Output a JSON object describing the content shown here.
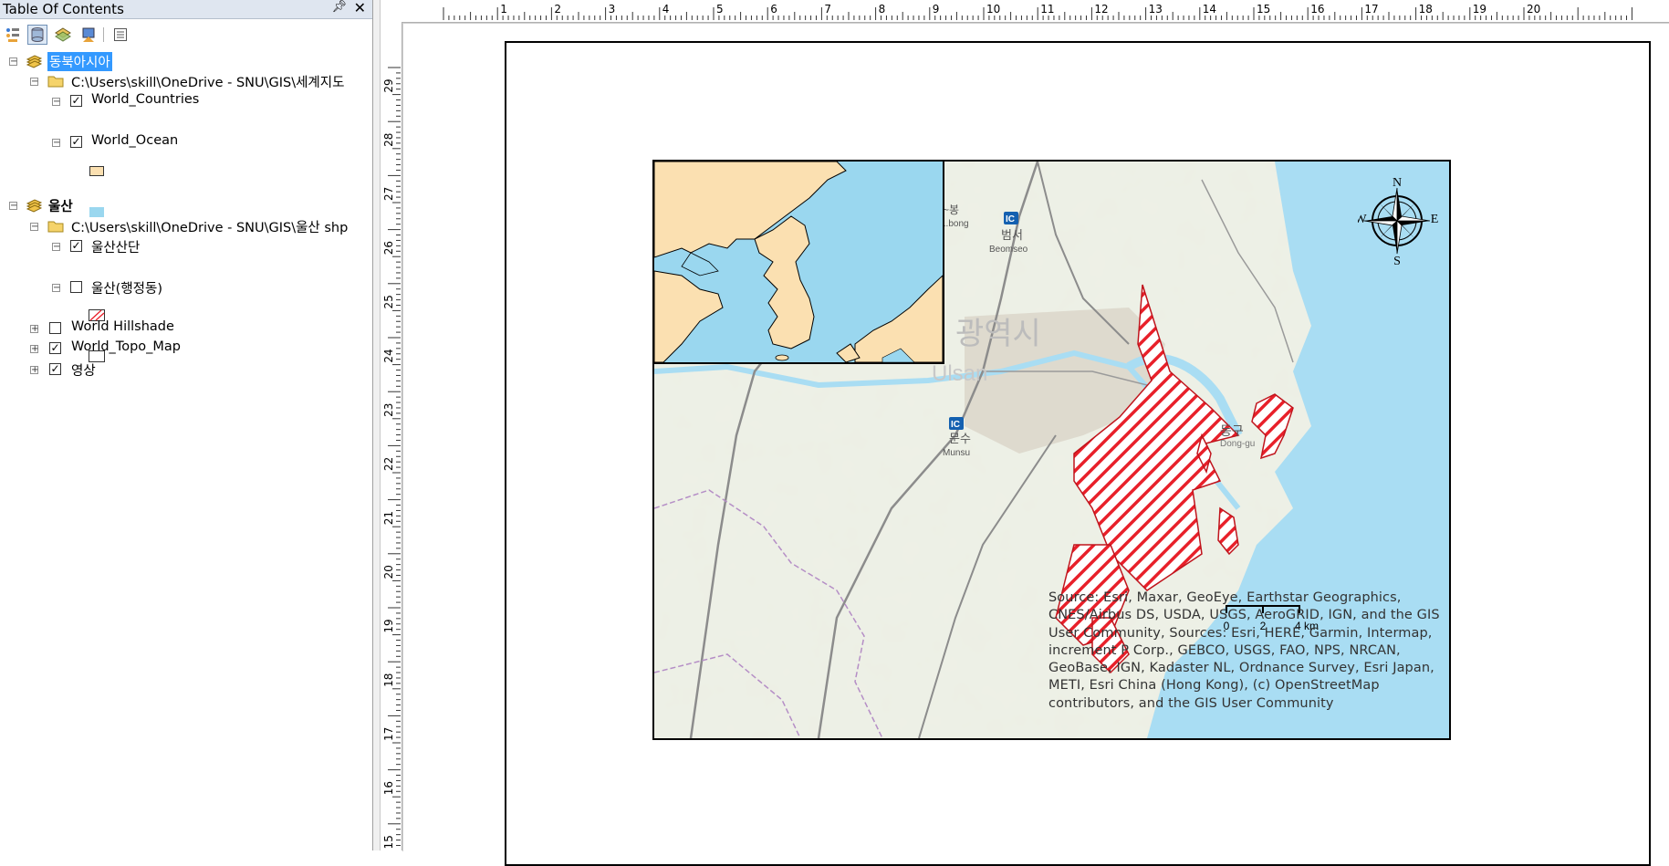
{
  "toc": {
    "title": "Table Of Contents",
    "groups": [
      {
        "name": "동북아시아",
        "selected": true,
        "source_path": "C:\\Users\\skill\\OneDrive - SNU\\GIS\\세계지도",
        "layers": [
          {
            "name": "World_Countries",
            "checked": true,
            "swatch_color": "#fbe0b1"
          },
          {
            "name": "World_Ocean",
            "checked": true,
            "swatch_color": "#9ad7ef"
          }
        ]
      },
      {
        "name": "울산",
        "selected": false,
        "source_path": "C:\\Users\\skill\\OneDrive - SNU\\GIS\\울산 shp",
        "layers": [
          {
            "name": "울산산단",
            "checked": true,
            "swatch": "red-hatch"
          },
          {
            "name": "울산(행정동)",
            "checked": false,
            "swatch": "hollow"
          }
        ]
      }
    ],
    "basemaps": [
      {
        "name": "World Hillshade",
        "checked": false
      },
      {
        "name": "World_Topo_Map",
        "checked": true
      },
      {
        "name": "영상",
        "checked": true
      }
    ]
  },
  "rulers": {
    "top_labels": [
      "1",
      "2",
      "3",
      "4",
      "5",
      "6",
      "7",
      "8",
      "9",
      "10",
      "11",
      "12",
      "13",
      "14",
      "15",
      "16",
      "17",
      "18",
      "19",
      "20"
    ],
    "left_labels": [
      "29",
      "28",
      "27",
      "26",
      "25",
      "24",
      "23",
      "22",
      "21",
      "20",
      "19",
      "18",
      "17",
      "16",
      "15"
    ]
  },
  "map": {
    "place_labels": {
      "city_ko": "광역시",
      "city_en": "Ulsan",
      "dong_gu_ko": "동구",
      "dong_gu_en": "Dong-gu",
      "beomseo_ko": "범서",
      "beomseo_en": "Beomseo",
      "munsu_ko": "문수",
      "munsu_en": "Munsu",
      "bong_ko": "~봉",
      "bong_en": "...bong",
      "ic": "IC"
    },
    "compass": {
      "n": "N",
      "s": "S",
      "e": "E",
      "w": "W"
    },
    "scalebar": {
      "labels": [
        "0",
        "2",
        "4 km"
      ]
    },
    "credits": "Source: Esri, Maxar, GeoEye, Earthstar Geographics, CNES/Airbus DS, USDA, USGS, AeroGRID, IGN, and the GIS User Community, Sources: Esri, HERE, Garmin, Intermap, increment P Corp., GEBCO, USGS, FAO, NPS, NRCAN, GeoBase, IGN, Kadaster NL, Ordnance Survey, Esri Japan, METI, Esri China (Hong Kong), (c) OpenStreetMap contributors, and the GIS User Community",
    "colors": {
      "land": "#fbe0b1",
      "ocean": "#9ad7ef",
      "industrial_hatch": "#e8202a"
    }
  }
}
